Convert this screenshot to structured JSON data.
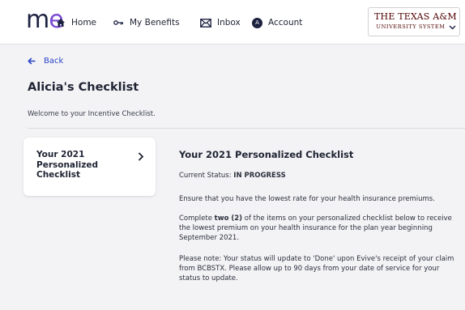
{
  "header": {
    "logo": {
      "m": "m",
      "e": "e"
    },
    "nav": [
      {
        "label": "Home",
        "icon": "home-icon"
      },
      {
        "label": "My Benefits",
        "icon": "key-icon"
      },
      {
        "label": "Inbox",
        "icon": "mail-icon"
      },
      {
        "label": "Account",
        "icon": "account-icon",
        "initial": "A"
      }
    ],
    "org": {
      "line1": "THE TEXAS A&M",
      "line2": "UNIVERSITY SYSTEM",
      "color": "#500000"
    }
  },
  "back_label": "Back",
  "page": {
    "title": "Alicia's Checklist",
    "subtitle": "Welcome to your Incentive Checklist."
  },
  "card": {
    "title": "Your 2021 Personalized Checklist"
  },
  "content": {
    "heading": "Your 2021 Personalized Checklist",
    "status_prefix": "Current Status: ",
    "status_value": "IN PROGRESS",
    "p1": "Ensure that you have the lowest rate for your health insurance premiums.",
    "p2_a": "Complete ",
    "p2_b": "two (2)",
    "p2_c": " of the items on your personalized checklist below to receive the lowest premium on your health insurance for the plan year beginning September 2021.",
    "p3": "Please note: Your status will update to 'Done' upon Evive's receipt of your claim from BCBSTX. Please allow up to 90 days from your date of service for your status to update."
  },
  "colors": {
    "brand_navy": "#1c2140",
    "brand_purple": "#7b4bd2",
    "link": "#2a45c8",
    "background": "#f3f3f5"
  }
}
